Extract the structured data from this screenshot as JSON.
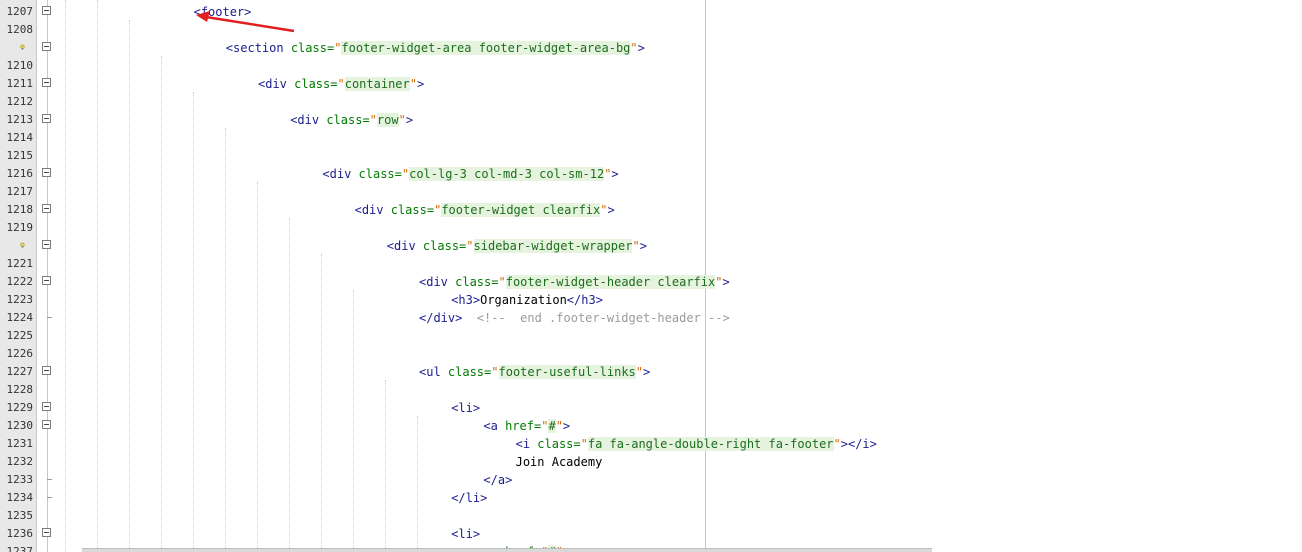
{
  "editor": {
    "lines": [
      {
        "n": "1207",
        "fold": "box",
        "indent": 4,
        "code": [
          {
            "t": "tag",
            "v": "<footer>"
          }
        ]
      },
      {
        "n": "1208",
        "fold": "none",
        "indent": 0,
        "code": []
      },
      {
        "n": "1209",
        "fold": "box",
        "bulb": true,
        "indent": 5,
        "code": [
          {
            "t": "tag",
            "v": "<section "
          },
          {
            "t": "attr",
            "v": "class"
          },
          {
            "t": "eq",
            "v": "="
          },
          {
            "t": "q",
            "v": "\""
          },
          {
            "t": "val",
            "v": "footer-widget-area footer-widget-area-bg"
          },
          {
            "t": "q",
            "v": "\""
          },
          {
            "t": "tag",
            "v": ">"
          }
        ]
      },
      {
        "n": "1210",
        "fold": "none",
        "indent": 0,
        "code": []
      },
      {
        "n": "1211",
        "fold": "box",
        "indent": 6,
        "code": [
          {
            "t": "tag",
            "v": "<div "
          },
          {
            "t": "attr",
            "v": "class"
          },
          {
            "t": "eq",
            "v": "="
          },
          {
            "t": "q",
            "v": "\""
          },
          {
            "t": "val",
            "v": "container"
          },
          {
            "t": "q",
            "v": "\""
          },
          {
            "t": "tag",
            "v": ">"
          }
        ]
      },
      {
        "n": "1212",
        "fold": "none",
        "indent": 0,
        "code": []
      },
      {
        "n": "1213",
        "fold": "box",
        "indent": 7,
        "code": [
          {
            "t": "tag",
            "v": "<div "
          },
          {
            "t": "attr",
            "v": "class"
          },
          {
            "t": "eq",
            "v": "="
          },
          {
            "t": "q",
            "v": "\""
          },
          {
            "t": "val",
            "v": "row"
          },
          {
            "t": "q",
            "v": "\""
          },
          {
            "t": "tag",
            "v": ">"
          }
        ]
      },
      {
        "n": "1214",
        "fold": "none",
        "indent": 0,
        "code": []
      },
      {
        "n": "1215",
        "fold": "none",
        "indent": 0,
        "code": []
      },
      {
        "n": "1216",
        "fold": "box",
        "indent": 8,
        "code": [
          {
            "t": "tag",
            "v": "<div "
          },
          {
            "t": "attr",
            "v": "class"
          },
          {
            "t": "eq",
            "v": "="
          },
          {
            "t": "q",
            "v": "\""
          },
          {
            "t": "val",
            "v": "col-lg-3 col-md-3 col-sm-12"
          },
          {
            "t": "q",
            "v": "\""
          },
          {
            "t": "tag",
            "v": ">"
          }
        ]
      },
      {
        "n": "1217",
        "fold": "none",
        "indent": 0,
        "code": []
      },
      {
        "n": "1218",
        "fold": "box",
        "indent": 9,
        "code": [
          {
            "t": "tag",
            "v": "<div "
          },
          {
            "t": "attr",
            "v": "class"
          },
          {
            "t": "eq",
            "v": "="
          },
          {
            "t": "q",
            "v": "\""
          },
          {
            "t": "val",
            "v": "footer-widget clearfix"
          },
          {
            "t": "q",
            "v": "\""
          },
          {
            "t": "tag",
            "v": ">"
          }
        ]
      },
      {
        "n": "1219",
        "fold": "none",
        "indent": 0,
        "code": []
      },
      {
        "n": "1220",
        "fold": "box",
        "bulb": true,
        "indent": 10,
        "code": [
          {
            "t": "tag",
            "v": "<div "
          },
          {
            "t": "attr",
            "v": "class"
          },
          {
            "t": "eq",
            "v": "="
          },
          {
            "t": "q",
            "v": "\""
          },
          {
            "t": "val",
            "v": "sidebar-widget-wrapper"
          },
          {
            "t": "q",
            "v": "\""
          },
          {
            "t": "tag",
            "v": ">"
          }
        ]
      },
      {
        "n": "1221",
        "fold": "none",
        "indent": 0,
        "code": []
      },
      {
        "n": "1222",
        "fold": "box",
        "indent": 11,
        "code": [
          {
            "t": "tag",
            "v": "<div "
          },
          {
            "t": "attr",
            "v": "class"
          },
          {
            "t": "eq",
            "v": "="
          },
          {
            "t": "q",
            "v": "\""
          },
          {
            "t": "val",
            "v": "footer-widget-header clearfix"
          },
          {
            "t": "q",
            "v": "\""
          },
          {
            "t": "tag",
            "v": ">"
          }
        ]
      },
      {
        "n": "1223",
        "fold": "none",
        "indent": 12,
        "code": [
          {
            "t": "tag",
            "v": "<h3>"
          },
          {
            "t": "txt",
            "v": "Organization"
          },
          {
            "t": "tag",
            "v": "</h3>"
          }
        ]
      },
      {
        "n": "1224",
        "fold": "end",
        "indent": 11,
        "code": [
          {
            "t": "tag",
            "v": "</div>"
          },
          {
            "t": "cmt",
            "v": "  <!--  end .footer-widget-header -->"
          }
        ]
      },
      {
        "n": "1225",
        "fold": "none",
        "indent": 0,
        "code": []
      },
      {
        "n": "1226",
        "fold": "none",
        "indent": 0,
        "code": []
      },
      {
        "n": "1227",
        "fold": "box",
        "indent": 11,
        "code": [
          {
            "t": "tag",
            "v": "<ul "
          },
          {
            "t": "attr",
            "v": "class"
          },
          {
            "t": "eq",
            "v": "="
          },
          {
            "t": "q",
            "v": "\""
          },
          {
            "t": "val",
            "v": "footer-useful-links"
          },
          {
            "t": "q",
            "v": "\""
          },
          {
            "t": "tag",
            "v": ">"
          }
        ]
      },
      {
        "n": "1228",
        "fold": "none",
        "indent": 0,
        "code": []
      },
      {
        "n": "1229",
        "fold": "box",
        "indent": 12,
        "code": [
          {
            "t": "tag",
            "v": "<li>"
          }
        ]
      },
      {
        "n": "1230",
        "fold": "box",
        "indent": 13,
        "code": [
          {
            "t": "tag",
            "v": "<a "
          },
          {
            "t": "attr",
            "v": "href"
          },
          {
            "t": "eq",
            "v": "="
          },
          {
            "t": "q",
            "v": "\""
          },
          {
            "t": "val",
            "v": "#"
          },
          {
            "t": "q",
            "v": "\""
          },
          {
            "t": "tag",
            "v": ">"
          }
        ]
      },
      {
        "n": "1231",
        "fold": "none",
        "indent": 14,
        "code": [
          {
            "t": "tag",
            "v": "<i "
          },
          {
            "t": "attr",
            "v": "class"
          },
          {
            "t": "eq",
            "v": "="
          },
          {
            "t": "q",
            "v": "\""
          },
          {
            "t": "val",
            "v": "fa fa-angle-double-right fa-footer"
          },
          {
            "t": "q",
            "v": "\""
          },
          {
            "t": "tag",
            "v": "></i>"
          }
        ]
      },
      {
        "n": "1232",
        "fold": "none",
        "indent": 14,
        "code": [
          {
            "t": "txt",
            "v": "Join Academy"
          }
        ]
      },
      {
        "n": "1233",
        "fold": "end",
        "indent": 13,
        "code": [
          {
            "t": "tag",
            "v": "</a>"
          }
        ]
      },
      {
        "n": "1234",
        "fold": "end",
        "indent": 12,
        "code": [
          {
            "t": "tag",
            "v": "</li>"
          }
        ]
      },
      {
        "n": "1235",
        "fold": "none",
        "indent": 0,
        "code": []
      },
      {
        "n": "1236",
        "fold": "box",
        "indent": 12,
        "code": [
          {
            "t": "tag",
            "v": "<li>"
          }
        ]
      },
      {
        "n": "1237",
        "fold": "none",
        "indent": 13,
        "code": [
          {
            "t": "tag",
            "v": "<a "
          },
          {
            "t": "attr",
            "v": "href"
          },
          {
            "t": "eq",
            "v": "="
          },
          {
            "t": "q",
            "v": "\""
          },
          {
            "t": "val",
            "v": "#"
          },
          {
            "t": "q",
            "v": "\""
          },
          {
            "t": "tag",
            "v": ">"
          }
        ]
      }
    ]
  },
  "annotation": {
    "color": "#e02020",
    "icon": "red-arrow-icon"
  },
  "colors": {
    "tag": "#1c1c8f",
    "attr": "#007a00",
    "string": "#d56a00",
    "value_bg": "#e6f3df",
    "comment": "#9b9b9b",
    "gutter": "#e8e8e8",
    "margin": "#f3b5a8"
  }
}
